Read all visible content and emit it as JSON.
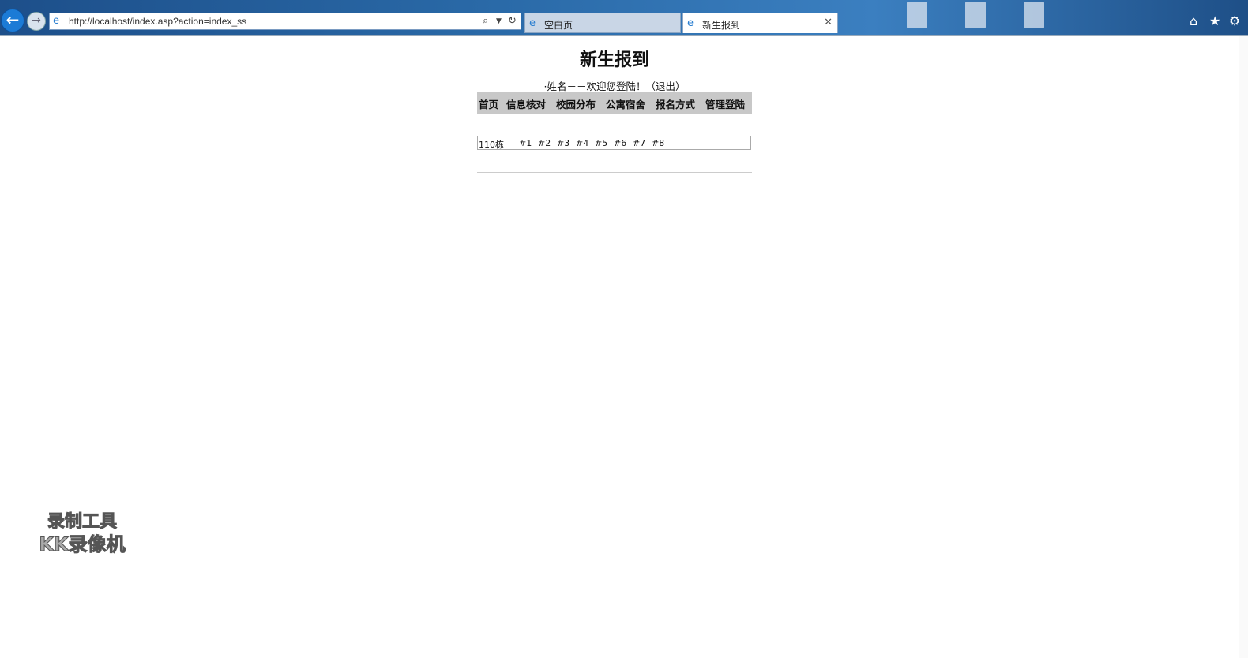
{
  "browser": {
    "address": "http://localhost/index.asp?action=index_ss",
    "tabs": [
      {
        "label": "空白页",
        "active": false
      },
      {
        "label": "新生报到",
        "active": true
      }
    ],
    "accent": "#1c7bd6"
  },
  "page": {
    "title": "新生报到",
    "welcome": "·姓名－－欢迎您登陆！（退出）",
    "menu": [
      "首页",
      "信息核对",
      "校园分布",
      "公寓宿舍",
      "报名方式",
      "管理登陆"
    ],
    "building": {
      "name": "110栋",
      "rooms": [
        "#1",
        "#2",
        "#3",
        "#4",
        "#5",
        "#6",
        "#7",
        "#8"
      ]
    }
  },
  "watermark": {
    "line1": "录制工具",
    "line2": "KK录像机"
  }
}
